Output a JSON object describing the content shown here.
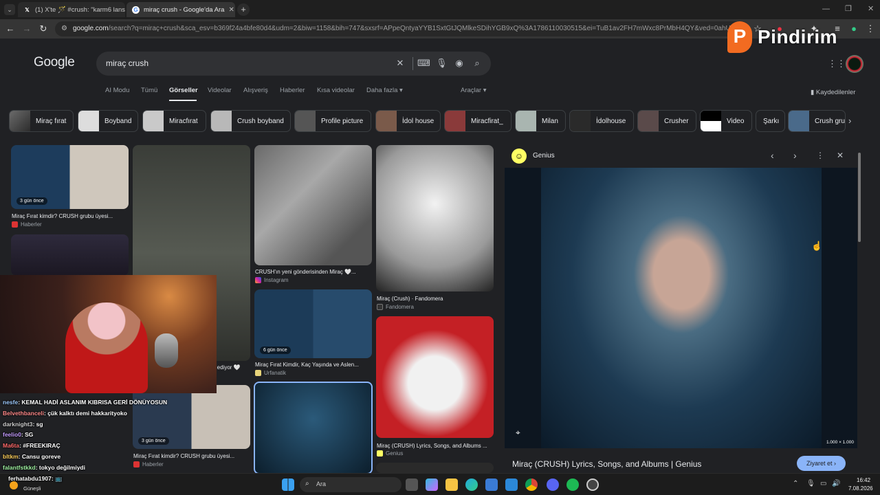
{
  "browser": {
    "tabs": [
      {
        "title": "(1) X'te 🪄 #crush: \"karm6 lansı",
        "active": false
      },
      {
        "title": "miraç crush - Google'da Ara",
        "active": true
      }
    ],
    "url_host": "google.com",
    "url_rest": "/search?q=miraç+crush&sca_esv=b369f24a4bfe80d4&udm=2&biw=1158&bih=747&sxsrf=APpeQntyaYYB1SxtGtJQMlkeSDihYGB9xQ%3A1786110030515&ei=TuB1av2FH7mWxc8PrMbH4QY&ved=0ahUKEwj95Jev0o6WA"
  },
  "google": {
    "logo": "Google",
    "query": "miraç crush",
    "tabs": [
      "AI Modu",
      "Tümü",
      "Görseller",
      "Videolar",
      "Alışveriş",
      "Haberler",
      "Kısa videolar",
      "Daha fazla ▾"
    ],
    "selected_tab": "Görseller",
    "tools": "Araçlar ▾",
    "saved": "Kaydedilenler",
    "chips": [
      "Miraç fırat",
      "Boyband",
      "Miracfırat",
      "Crush boyband",
      "Profile picture",
      "İdol house",
      "Miracfirat_",
      "Milan",
      "İdolhouse",
      "Crusher",
      "Video",
      "Şarkı",
      "Crush grup"
    ]
  },
  "results": [
    {
      "caption": "Miraç Fırat kimdir? CRUSH grubu üyesi...",
      "source": "Haberler",
      "badge": "3 gün önce"
    },
    {
      "caption": "...ediyor 🤍",
      "source": "",
      "badge": ""
    },
    {
      "caption": "CRUSH'ın yeni gönderisinden Miraç 🤍...",
      "source": "Instagram",
      "badge": ""
    },
    {
      "caption": "Miraç (Crush) · Fandomera",
      "source": "Fandomera",
      "badge": ""
    },
    {
      "caption": "Miraç Fırat Kimdir, Kaç Yaşında ve Aslen...",
      "source": "Urfanatik",
      "badge": "6 gün önce"
    },
    {
      "caption": "Miraç (CRUSH) Lyrics, Songs, and Albums ...",
      "source": "Genius",
      "badge": ""
    },
    {
      "caption": "Miraç Fırat kimdir? CRUSH grubu üyesi...",
      "source": "Haberler",
      "badge": "3 gün önce"
    }
  ],
  "panel": {
    "source": "Genius",
    "dimensions": "1.000 × 1.000",
    "title": "Miraç (CRUSH) Lyrics, Songs, and Albums | Genius",
    "visit": "Ziyaret et ›"
  },
  "chat": [
    {
      "user": "nesfe",
      "msg": ": KEMAL HADİ ASLANIM KIBRISA GERİ DÖNÜYOSUN",
      "color": "#9ecbff"
    },
    {
      "user": "Belvethbanceli",
      "msg": ": çük kalktı demi hakkarityoko",
      "color": "#ff8a8a"
    },
    {
      "user": "darknight3",
      "msg": ": sg",
      "color": "#cfcfcf"
    },
    {
      "user": "feelio0",
      "msg": ": SG",
      "color": "#c39bff"
    },
    {
      "user": "Ma6ta",
      "msg": ": #FREEKIRAÇ",
      "color": "#ff6b6b"
    },
    {
      "user": "bltkm",
      "msg": ": Cansu goreve",
      "color": "#ffcf5c"
    },
    {
      "user": "falantfstkkd",
      "msg": ": tokyo değilmiydi",
      "color": "#9ef0a0"
    },
    {
      "user": "ferhatabdu1907",
      "msg": ": 📺",
      "color": "#ffffff"
    }
  ],
  "watermark": {
    "letter": "P",
    "text": "Pindirim"
  },
  "taskbar": {
    "weather": "Güneşli",
    "search": "Ara",
    "time": "16:42",
    "date": "7.08.2026"
  }
}
